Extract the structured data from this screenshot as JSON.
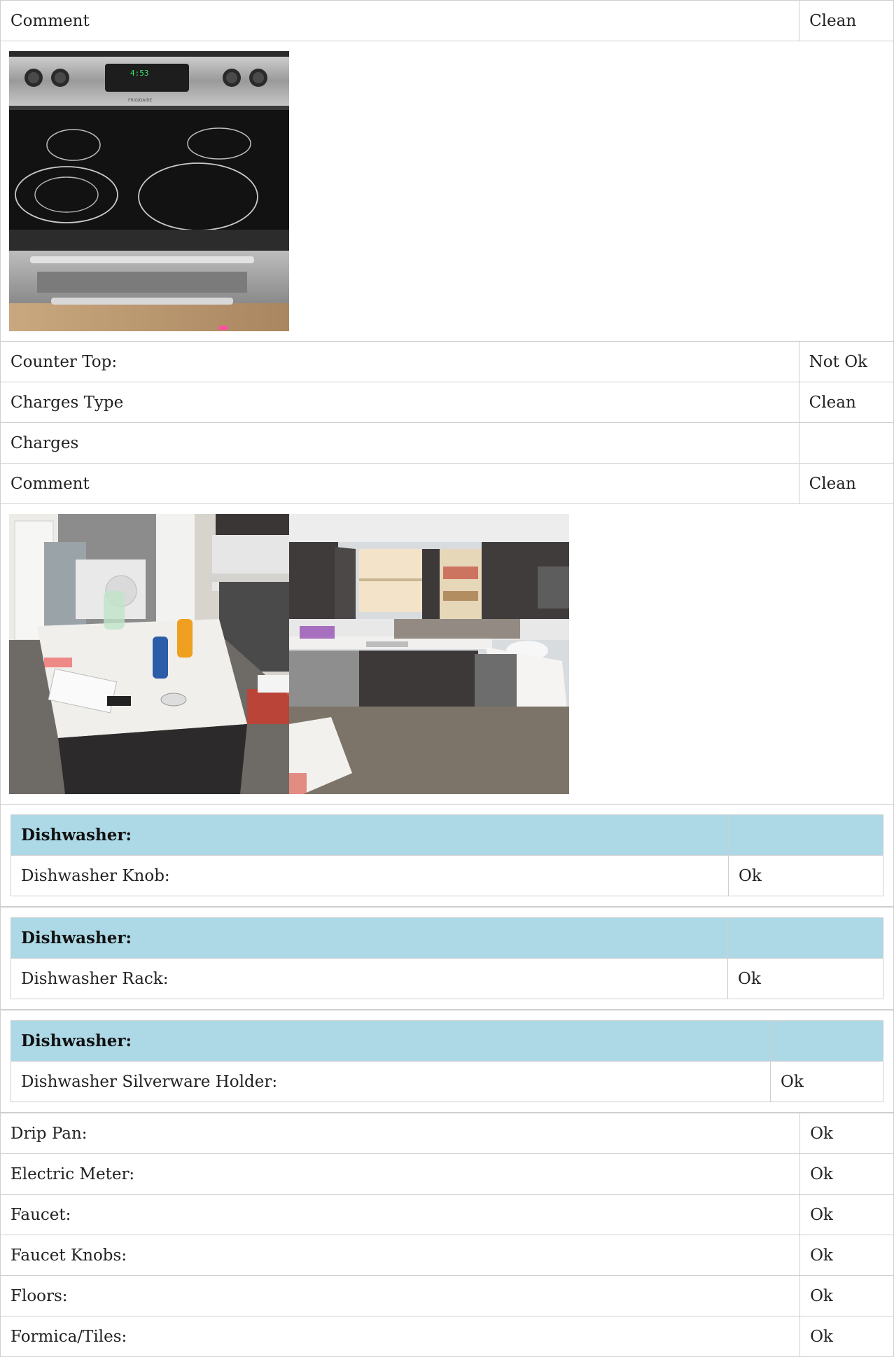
{
  "rows_top": [
    {
      "label": "Comment",
      "value": "Clean"
    }
  ],
  "photo_set_1": {
    "photos": [
      {
        "name": "stove-photo",
        "display_text": "4:53",
        "brand_text": "FRIGIDAIRE"
      }
    ]
  },
  "rows_mid": [
    {
      "label": "Counter Top:",
      "value": "Not Ok"
    },
    {
      "label": "Charges Type",
      "value": "Clean"
    },
    {
      "label": "Charges",
      "value": ""
    },
    {
      "label": "Comment",
      "value": "Clean"
    }
  ],
  "photo_set_2": {
    "photos": [
      {
        "name": "kitchen-island-photo"
      },
      {
        "name": "kitchen-cabinets-photo"
      }
    ]
  },
  "dishwasher_blocks": [
    {
      "header": "Dishwasher:",
      "label": "Dishwasher Knob:",
      "value": "Ok"
    },
    {
      "header": "Dishwasher:",
      "label": "Dishwasher Rack:",
      "value": "Ok"
    },
    {
      "header": "Dishwasher:",
      "label": "Dishwasher Silverware Holder:",
      "value": "Ok"
    }
  ],
  "rows_bottom": [
    {
      "label": "Drip Pan:",
      "value": "Ok"
    },
    {
      "label": "Electric Meter:",
      "value": "Ok"
    },
    {
      "label": "Faucet:",
      "value": "Ok"
    },
    {
      "label": "Faucet Knobs:",
      "value": "Ok"
    },
    {
      "label": "Floors:",
      "value": "Ok"
    },
    {
      "label": "Formica/Tiles:",
      "value": "Ok"
    }
  ],
  "colors": {
    "header_bg": "#add8e6",
    "border": "#cfcfcf",
    "text": "#222222"
  }
}
